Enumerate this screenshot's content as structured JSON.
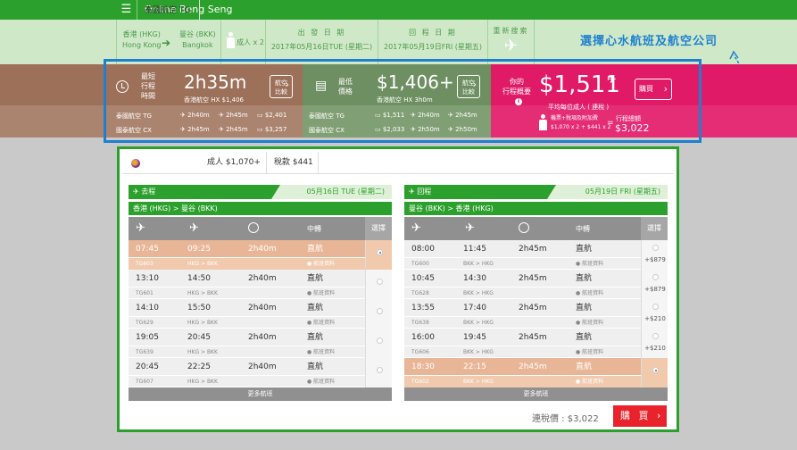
{
  "header": {
    "menu_icon": "☰",
    "brand": "Online Beng Seng"
  },
  "search": {
    "origin_city": "香港 (HKG)",
    "origin_en": "Hong Kong",
    "dest_city": "曼谷 (BKK)",
    "dest_en": "Bangkok",
    "passengers": "成人 x 2",
    "depart_label": "出 發 日 期",
    "depart_value": "2017年05月16日TUE (星期二)",
    "return_label": "回 程 日 期",
    "return_value": "2017年05月19日FRI (星期五)",
    "research_label": "重新搜索"
  },
  "annotation": "選擇心水航班及航空公司",
  "summary": {
    "shortest": {
      "label1": "最短",
      "label2": "行程",
      "label3": "時間",
      "value": "2h35m",
      "sub": "香港航空 HX  $1,406",
      "compare": "航空\n比較",
      "rows": [
        {
          "airline": "泰國航空 TG",
          "out": "2h40m",
          "ret": "2h45m",
          "price": "$2,401"
        },
        {
          "airline": "國泰航空 CX",
          "out": "2h45m",
          "ret": "2h45m",
          "price": "$3,257"
        }
      ]
    },
    "cheapest": {
      "label1": "最低",
      "label2": "價格",
      "value": "$1,406+",
      "sub": "香港航空 HX   3h0m",
      "compare": "航空\n比較",
      "rows": [
        {
          "airline": "泰國航空 TG",
          "price": "$1,511",
          "out": "2h40m",
          "ret": "2h45m"
        },
        {
          "airline": "國泰航空 CX",
          "price": "$2,033",
          "out": "2h50m",
          "ret": "2h50m"
        }
      ]
    },
    "yours": {
      "label1": "你的",
      "label2": "行程概要",
      "value": "$1,511",
      "per": "平均每位成人 ( 連稅 )",
      "buy": "購買",
      "breakdown1": "機票+稅項及附加費",
      "breakdown2": "$1,070 x 2 + $441 x 2",
      "total_label": "行程總額",
      "total": "$3,022"
    }
  },
  "tabs": [
    {
      "label": "泰國航空 TG"
    },
    {
      "label": "成人 $1,070+"
    },
    {
      "label": "稅款 $441"
    }
  ],
  "outbound": {
    "title": "去程",
    "date": "05月16日 TUE (星期二)",
    "route": "香港 (HKG) > 曼谷 (BKK)",
    "col_transfer": "中轉",
    "col_select": "選擇",
    "flights": [
      {
        "dep": "07:45",
        "arr": "09:25",
        "dur": "2h40m",
        "stop": "直航",
        "code": "TG603",
        "seg": "HKG > BKK",
        "info": "航班資料",
        "selected": true,
        "add": ""
      },
      {
        "dep": "13:10",
        "arr": "14:50",
        "dur": "2h40m",
        "stop": "直航",
        "code": "TG601",
        "seg": "HKG > BKK",
        "info": "航班資料",
        "selected": false,
        "add": ""
      },
      {
        "dep": "14:10",
        "arr": "15:50",
        "dur": "2h40m",
        "stop": "直航",
        "code": "TG629",
        "seg": "HKG > BKK",
        "info": "航班資料",
        "selected": false,
        "add": ""
      },
      {
        "dep": "19:05",
        "arr": "20:45",
        "dur": "2h40m",
        "stop": "直航",
        "code": "TG639",
        "seg": "HKG > BKK",
        "info": "航班資料",
        "selected": false,
        "add": ""
      },
      {
        "dep": "20:45",
        "arr": "22:25",
        "dur": "2h40m",
        "stop": "直航",
        "code": "TG607",
        "seg": "HKG > BKK",
        "info": "航班資料",
        "selected": false,
        "add": ""
      }
    ],
    "more": "更多航班"
  },
  "inbound": {
    "title": "回程",
    "date": "05月19日 FRI (星期五)",
    "route": "曼谷 (BKK) > 香港 (HKG)",
    "col_transfer": "中轉",
    "col_select": "選擇",
    "flights": [
      {
        "dep": "08:00",
        "arr": "11:45",
        "dur": "2h45m",
        "stop": "直航",
        "code": "TG600",
        "seg": "BKK > HKG",
        "info": "航班資料",
        "selected": false,
        "add": "+$879"
      },
      {
        "dep": "10:45",
        "arr": "14:30",
        "dur": "2h45m",
        "stop": "直航",
        "code": "TG628",
        "seg": "BKK > HKG",
        "info": "航班資料",
        "selected": false,
        "add": "+$879"
      },
      {
        "dep": "13:55",
        "arr": "17:40",
        "dur": "2h45m",
        "stop": "直航",
        "code": "TG638",
        "seg": "BKK > HKG",
        "info": "航班資料",
        "selected": false,
        "add": "+$210"
      },
      {
        "dep": "16:00",
        "arr": "19:45",
        "dur": "2h45m",
        "stop": "直航",
        "code": "TG606",
        "seg": "BKK > HKG",
        "info": "航班資料",
        "selected": false,
        "add": "+$210"
      },
      {
        "dep": "18:30",
        "arr": "22:15",
        "dur": "2h45m",
        "stop": "直航",
        "code": "TG602",
        "seg": "BKK > HKG",
        "info": "航班資料",
        "selected": true,
        "add": ""
      }
    ],
    "more": "更多航班"
  },
  "footer": {
    "total_label": "連稅價 : $3,022",
    "buy": "購 買  ›"
  },
  "colors": {
    "green": "#2ca02c",
    "brown": "#9c7059",
    "olive": "#6e8f62",
    "pink": "#e01a67",
    "highlight": "#1f7fcf"
  }
}
